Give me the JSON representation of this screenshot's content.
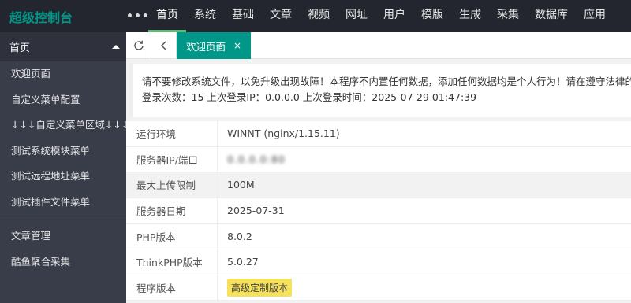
{
  "app": {
    "title": "超级控制台",
    "more_label": "•••"
  },
  "topnav": [
    {
      "label": "首页",
      "active": true
    },
    {
      "label": "系统"
    },
    {
      "label": "基础"
    },
    {
      "label": "文章"
    },
    {
      "label": "视频"
    },
    {
      "label": "网址"
    },
    {
      "label": "用户"
    },
    {
      "label": "模版"
    },
    {
      "label": "生成"
    },
    {
      "label": "采集"
    },
    {
      "label": "数据库"
    },
    {
      "label": "应用"
    }
  ],
  "sidebar": {
    "header": "首页",
    "items": [
      "欢迎页面",
      "自定义菜单配置",
      "↓↓↓自定义菜单区域↓↓↓",
      "测试系统模块菜单",
      "测试远程地址菜单",
      "测试插件文件菜单"
    ],
    "items2": [
      "文章管理",
      "酷鱼聚合采集"
    ]
  },
  "tabs": {
    "active_label": "欢迎页面",
    "close": "×"
  },
  "notice": {
    "line1": "请不要修改系统文件，以免升级出现故障！本程序不内置任何数据，添加任何数据均是个人行为！请在遵守法律的前提下使用",
    "line2": "登录次数：15 上次登录IP：0.0.0.0 上次登录时间：2025-07-29 01:47:39"
  },
  "info": [
    {
      "key": "运行环境",
      "value": "WINNT (nginx/1.15.11)"
    },
    {
      "key": "服务器IP/端口",
      "value": "0.0.0.0:80",
      "blurred": true
    },
    {
      "key": "最大上传限制",
      "value": "100M"
    },
    {
      "key": "服务器日期",
      "value": "2025-07-31"
    },
    {
      "key": "PHP版本",
      "value": "8.0.2"
    },
    {
      "key": "ThinkPHP版本",
      "value": "5.0.27"
    },
    {
      "key": "程序版本",
      "value": "高级定制版本",
      "badge": true
    }
  ],
  "colors": {
    "accent": "#009688",
    "topbar": "#23262e",
    "sidebar": "#393d49",
    "badge": "#f5e15c"
  }
}
